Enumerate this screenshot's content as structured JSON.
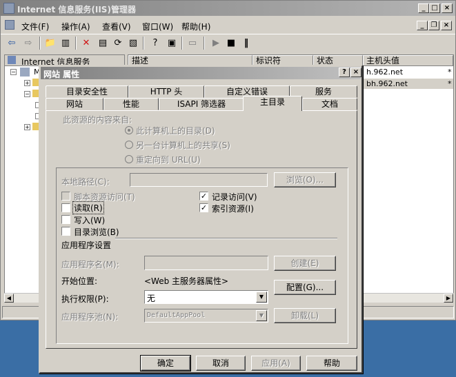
{
  "main": {
    "title": "Internet 信息服务(IIS)管理器",
    "menu": [
      "文件(F)",
      "操作(A)",
      "查看(V)",
      "窗口(W)",
      "帮助(H)"
    ],
    "tree_header": "Internet 信息服务",
    "tree_root_partial": "M",
    "columns": [
      "描述",
      "标识符",
      "状态",
      "主机头值"
    ],
    "host_values": [
      "h.962.net",
      "bh.962.net"
    ],
    "row_marks": [
      "*",
      "*"
    ]
  },
  "dialog": {
    "title": "网站 属性",
    "tabs_row1": [
      "目录安全性",
      "HTTP 头",
      "自定义错误",
      "服务"
    ],
    "tabs_row2": [
      "网站",
      "性能",
      "ISAPI 筛选器",
      "主目录",
      "文档"
    ],
    "source_label": "此资源的内容来自:",
    "radios": [
      "此计算机上的目录(D)",
      "另一台计算机上的共享(S)",
      "重定向到 URL(U)"
    ],
    "local_path_label": "本地路径(C):",
    "browse_btn": "浏览(O)...",
    "checkboxes_left": [
      "脚本资源访问(T)",
      "读取(R)",
      "写入(W)",
      "目录浏览(B)"
    ],
    "checkboxes_right": [
      "记录访问(V)",
      "索引资源(I)"
    ],
    "app_settings": "应用程序设置",
    "app_name_label": "应用程序名(M):",
    "create_btn": "创建(E)",
    "start_pos_label": "开始位置:",
    "start_pos_value": "<Web 主服务器属性>",
    "config_btn": "配置(G)...",
    "exec_perm_label": "执行权限(P):",
    "exec_perm_value": "无",
    "app_pool_label": "应用程序池(N):",
    "app_pool_value": "DefaultAppPool",
    "unload_btn": "卸载(L)",
    "ok_btn": "确定",
    "cancel_btn": "取消",
    "apply_btn": "应用(A)",
    "help_btn": "帮助"
  }
}
